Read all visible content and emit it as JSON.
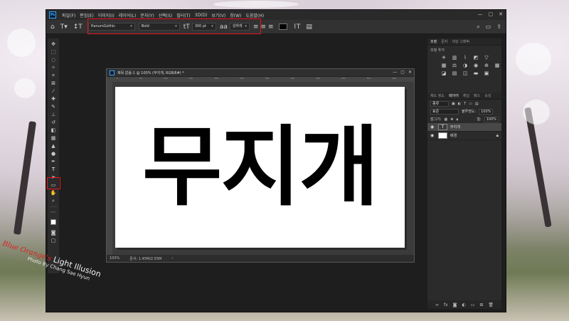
{
  "app": {
    "logo": "Ps",
    "menu": [
      "파일(F)",
      "편집(E)",
      "이미지(I)",
      "레이어(L)",
      "문자(Y)",
      "선택(S)",
      "필터(T)",
      "3D(D)",
      "보기(V)",
      "창(W)",
      "도움말(H)"
    ],
    "window_controls": [
      "—",
      "▢",
      "✕"
    ]
  },
  "options_bar": {
    "font_family": "HanumGothic",
    "font_style": "Bold",
    "font_size": "300 pt",
    "antialias": "강하게",
    "text_color": "#000000"
  },
  "document": {
    "tab_title": "제목 없음-1 @ 100% (무지개, RGB/8#) *",
    "ruler_ticks": [
      "0",
      "50",
      "100",
      "150",
      "200",
      "250",
      "300",
      "350",
      "400",
      "450",
      "500",
      "550",
      "600",
      "650",
      "700",
      "750",
      "800",
      "850"
    ],
    "canvas_text": "무지개",
    "zoom": "100%",
    "status_info": "문서: 1.45M/2.55M"
  },
  "panels": {
    "top_tabs": [
      "조정",
      "문자",
      "색상 그래픽"
    ],
    "adjustments_title": "조정 추가",
    "layers_tabs": [
      "채도 정도",
      "레이어",
      "채널",
      "패스",
      "속성"
    ],
    "filter_label": "종류",
    "blend_mode": "표준",
    "opacity_label": "불투명도:",
    "opacity_value": "100%",
    "lock_label": "잠그기:",
    "fill_label": "칠:",
    "fill_value": "100%",
    "layers": [
      {
        "name": "무지개",
        "kind": "type",
        "selected": true
      },
      {
        "name": "배경",
        "kind": "raster",
        "selected": false,
        "locked": true
      }
    ]
  },
  "watermark": {
    "brand_red": "Blue Orange's",
    "brand_white": "Light Illusion",
    "credit": "Photo By Chang Sae Hyun"
  }
}
